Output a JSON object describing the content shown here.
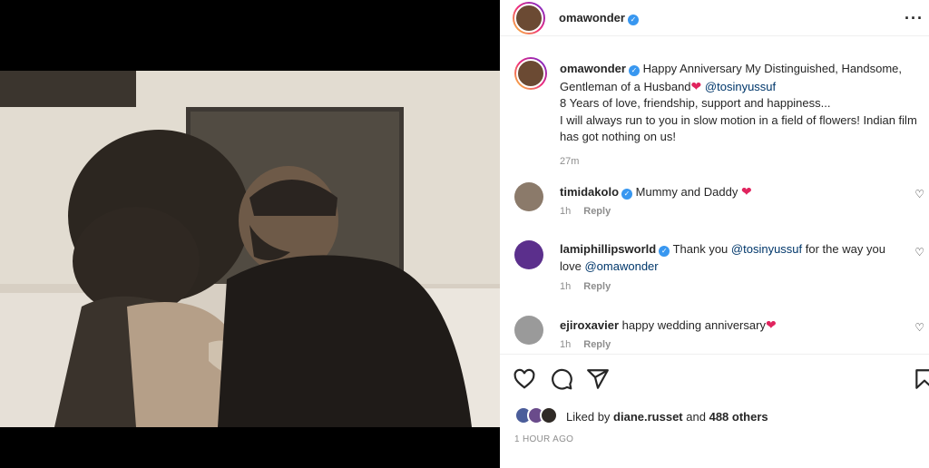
{
  "post": {
    "author": "omawonder"
  },
  "caption": {
    "username": "omawonder",
    "line1": "Happy Anniversary My Distinguished, Handsome, Gentleman of a Husband",
    "mention": "@tosinyussuf",
    "line2": "8 Years of love, friendship, support and happiness...",
    "line3": "I will always run to you in slow motion in a field of flowers! Indian film has got nothing on us!",
    "time": "27m"
  },
  "comments": [
    {
      "username": "timidakolo",
      "text": "Mummy and Daddy",
      "heart": true,
      "time": "1h",
      "reply": "Reply"
    },
    {
      "username": "lamiphillipsworld",
      "text_a": "Thank you",
      "mention_a": "@tosinyussuf",
      "text_b": "for the way you love",
      "mention_b": "@omawonder",
      "time": "1h",
      "reply": "Reply"
    },
    {
      "username": "ejiroxavier",
      "text": "happy wedding anniversary",
      "heart": true,
      "time": "1h",
      "reply": "Reply"
    }
  ],
  "likes": {
    "prefix": "Liked by",
    "user": "diane.russet",
    "middle": "and",
    "others": "488 others"
  },
  "posted": "1 HOUR AGO",
  "icons": {
    "more": "more-options-icon",
    "like": "heart-icon",
    "comment": "comment-icon",
    "share": "share-icon",
    "save": "bookmark-icon",
    "verified": "verified-badge-icon"
  },
  "colors": {
    "verified": "#3897f0",
    "heart": "#e0245e",
    "mention": "#00376b",
    "meta": "#8e8e8e"
  }
}
